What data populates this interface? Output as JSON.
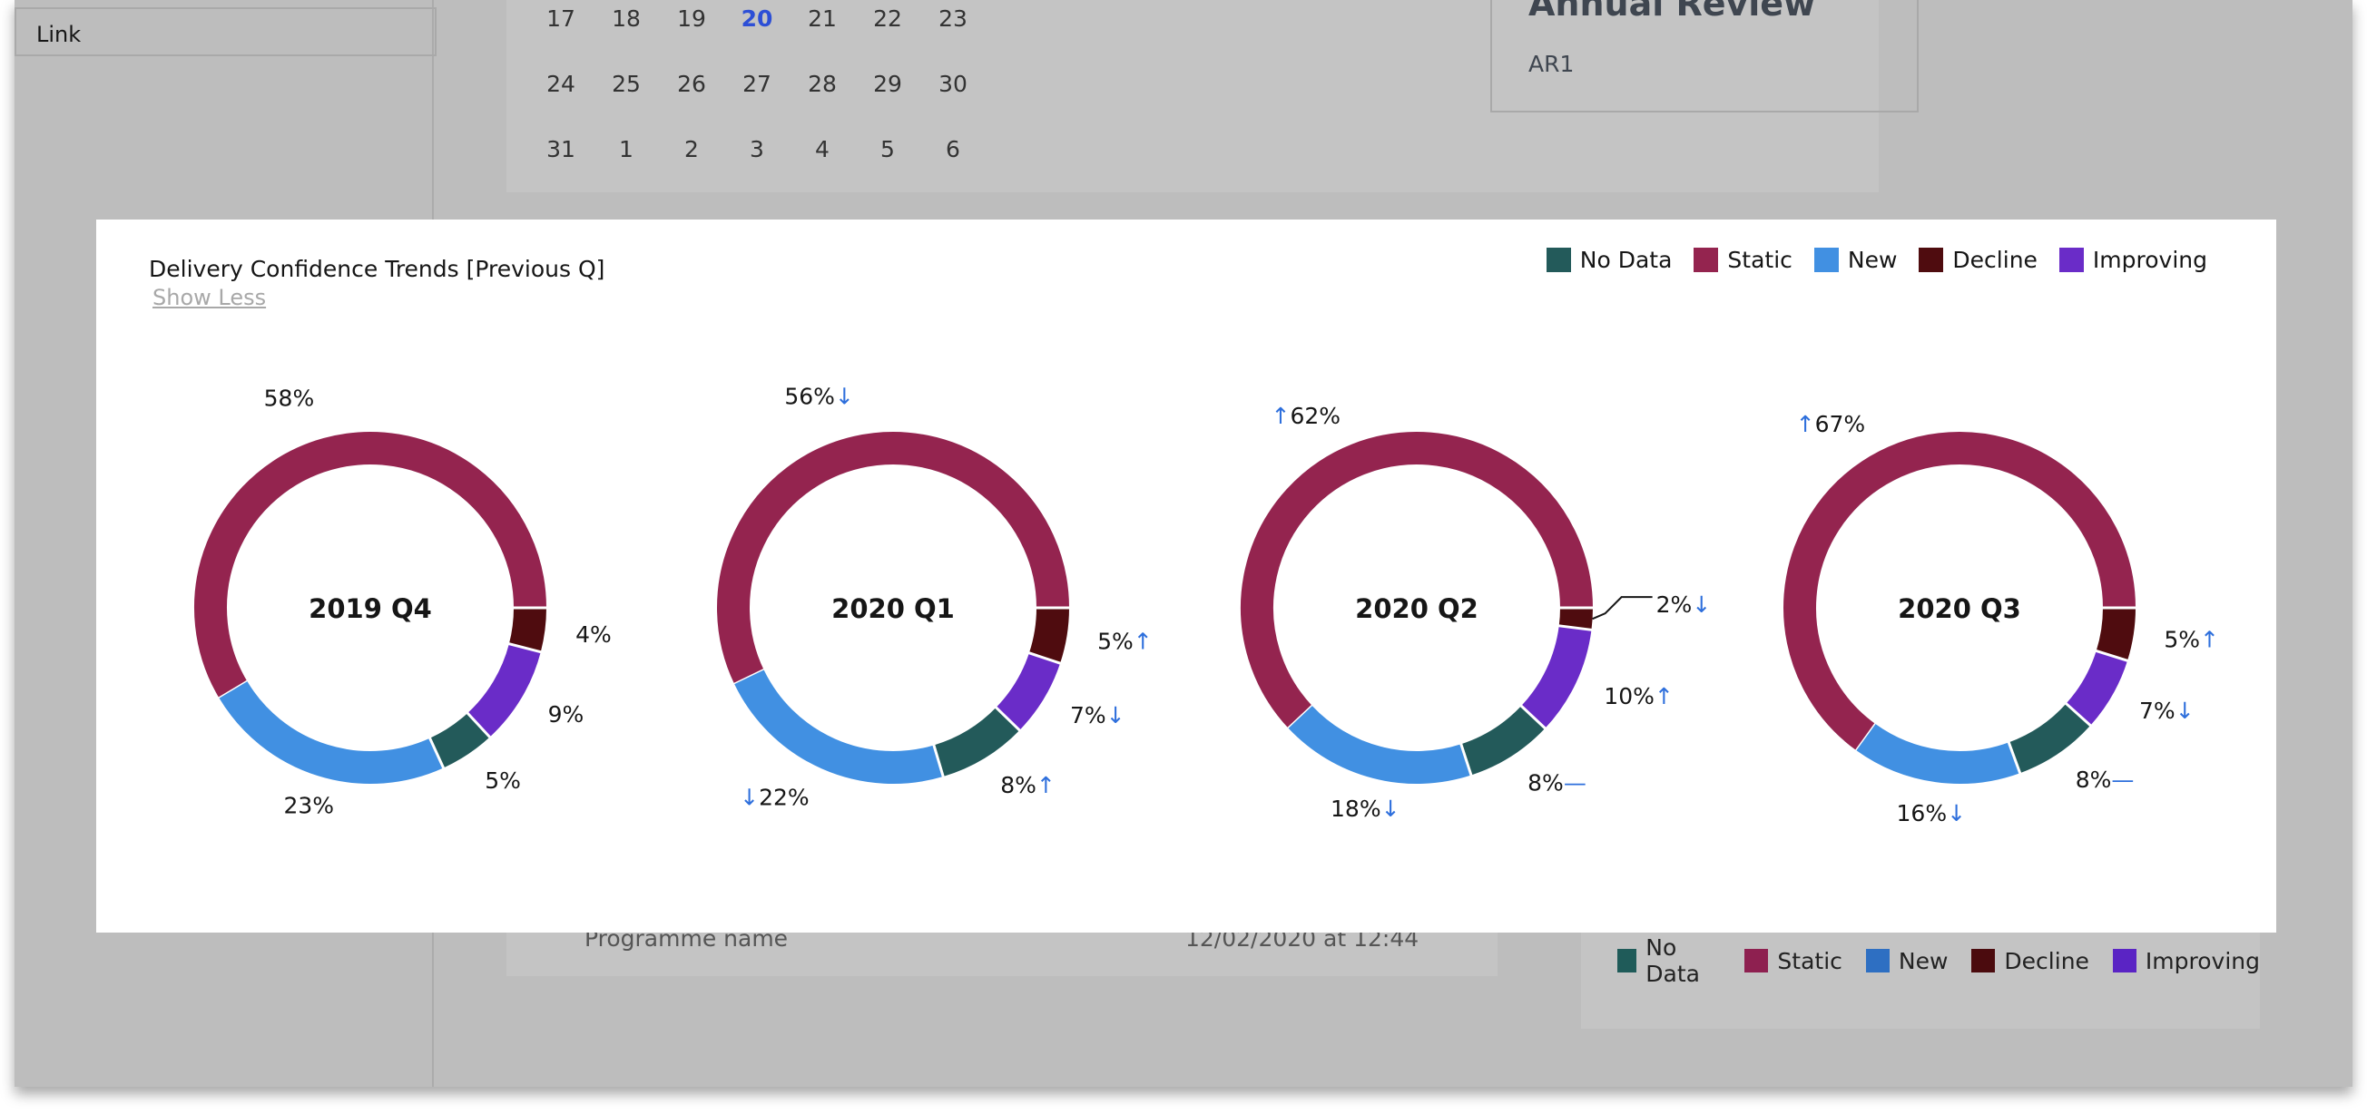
{
  "background": {
    "link_label": "Link",
    "calendar": {
      "rows": [
        [
          "17",
          "18",
          "19",
          "20",
          "21",
          "22",
          "23"
        ],
        [
          "24",
          "25",
          "26",
          "27",
          "28",
          "29",
          "30"
        ],
        [
          "31",
          "1",
          "2",
          "3",
          "4",
          "5",
          "6"
        ]
      ],
      "today": "20"
    },
    "review": {
      "title": "Annual Review",
      "subtitle": "AR1"
    },
    "programme": {
      "label": "Programme name",
      "date": "12/02/2020 at 12:44"
    },
    "legend": [
      {
        "label": "No Data",
        "color": "#1f5b59"
      },
      {
        "label": "Static",
        "color": "#8e2050"
      },
      {
        "label": "New",
        "color": "#2e6fc2"
      },
      {
        "label": "Decline",
        "color": "#4b0b0e"
      },
      {
        "label": "Improving",
        "color": "#5a24c4"
      }
    ]
  },
  "modal": {
    "title": "Delivery Confidence Trends [Previous Q]",
    "show_less": "Show Less",
    "legend": [
      {
        "label": "No Data",
        "color": "#235a5a"
      },
      {
        "label": "Static",
        "color": "#94244f"
      },
      {
        "label": "New",
        "color": "#4190e2"
      },
      {
        "label": "Decline",
        "color": "#4f0c0f"
      },
      {
        "label": "Improving",
        "color": "#6a2cc8"
      }
    ]
  },
  "chart_data": [
    {
      "type": "pie",
      "center_label": "2019 Q4",
      "categories": [
        "Static",
        "Decline",
        "Improving",
        "No Data",
        "New"
      ],
      "values": [
        58,
        4,
        9,
        5,
        23
      ],
      "value_labels": [
        "58%",
        "4%",
        "9%",
        "5%",
        "23%"
      ],
      "trend": [
        "",
        "",
        "",
        "",
        ""
      ]
    },
    {
      "type": "pie",
      "center_label": "2020 Q1",
      "categories": [
        "Static",
        "Decline",
        "Improving",
        "No Data",
        "New"
      ],
      "values": [
        56,
        5,
        7,
        8,
        22
      ],
      "value_labels": [
        "56%",
        "5%",
        "7%",
        "8%",
        "22%"
      ],
      "trend": [
        "down",
        "up",
        "down",
        "up",
        "down"
      ]
    },
    {
      "type": "pie",
      "center_label": "2020 Q2",
      "categories": [
        "Static",
        "Decline",
        "Improving",
        "No Data",
        "New"
      ],
      "values": [
        62,
        2,
        10,
        8,
        18
      ],
      "value_labels": [
        "62%",
        "2%",
        "10%",
        "8%",
        "18%"
      ],
      "trend": [
        "up",
        "down",
        "up",
        "flat",
        "down"
      ]
    },
    {
      "type": "pie",
      "center_label": "2020 Q3",
      "categories": [
        "Static",
        "Decline",
        "Improving",
        "No Data",
        "New"
      ],
      "values": [
        67,
        5,
        7,
        8,
        16
      ],
      "value_labels": [
        "67%",
        "5%",
        "7%",
        "8%",
        "16%"
      ],
      "trend": [
        "up",
        "up",
        "down",
        "flat",
        "down"
      ]
    }
  ]
}
